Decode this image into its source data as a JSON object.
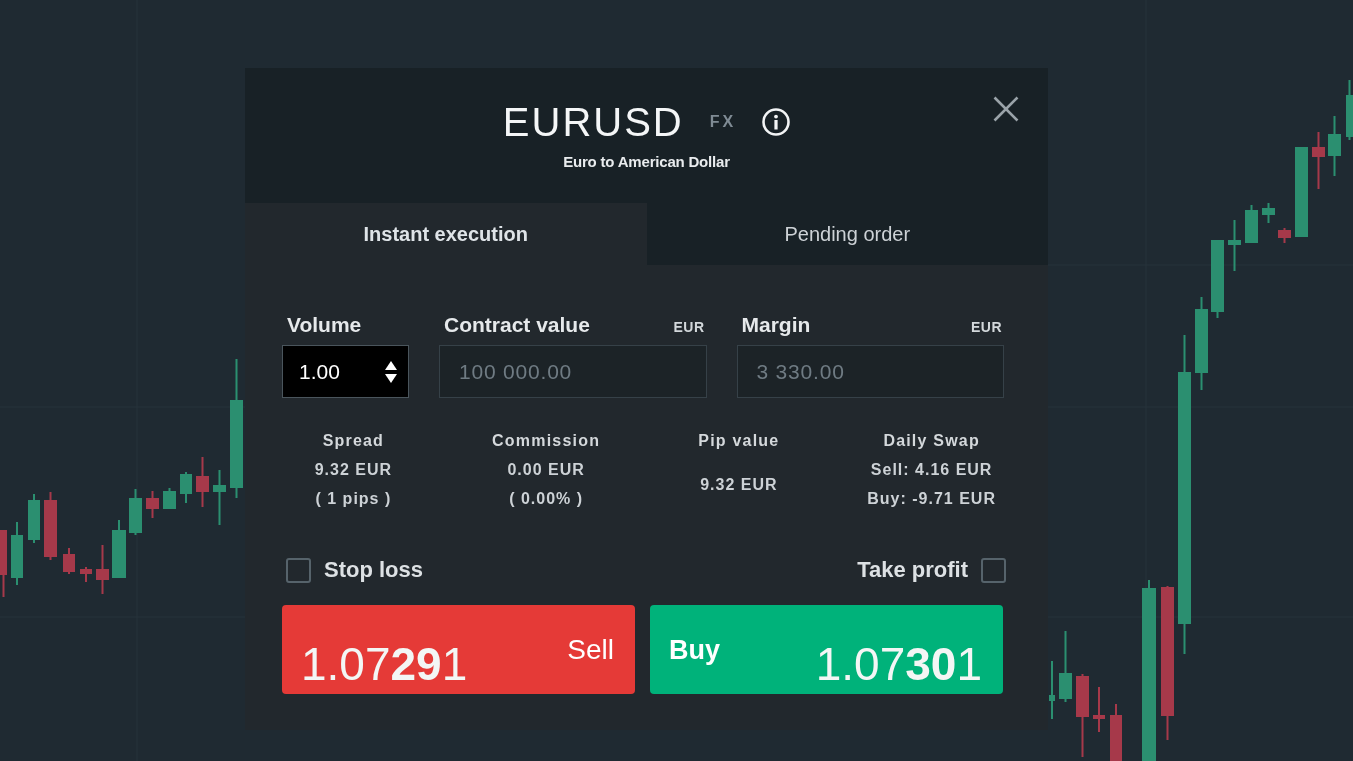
{
  "dialog": {
    "title": "EURUSD",
    "market_tag": "FX",
    "subtitle": "Euro to American Dollar",
    "tabs": [
      {
        "label": "Instant execution",
        "selected": true
      },
      {
        "label": "Pending order",
        "selected": false
      }
    ],
    "fields": [
      {
        "kind": "spinner",
        "label": "Volume",
        "value": "1.00",
        "disabled": false
      },
      {
        "kind": "text",
        "label": "Contract value",
        "unit": "EUR",
        "value": "100 000.00",
        "disabled": true
      },
      {
        "kind": "text",
        "label": "Margin",
        "unit": "EUR",
        "value": "3 330.00",
        "disabled": true
      }
    ],
    "stats": [
      {
        "title": "Spread",
        "lines": [
          "9.32 EUR",
          "( 1 pips )"
        ]
      },
      {
        "title": "Commission",
        "lines": [
          "0.00 EUR",
          "( 0.00% )"
        ]
      },
      {
        "title": "Pip value",
        "lines": [
          "9.32 EUR"
        ]
      },
      {
        "title": "Daily Swap",
        "lines": [
          "Sell: 4.16 EUR",
          "Buy: -9.71 EUR"
        ]
      }
    ],
    "options": [
      {
        "label": "Stop loss",
        "checked": false
      },
      {
        "label": "Take profit",
        "checked": false
      }
    ],
    "order_buttons": [
      {
        "kind": "sell",
        "label": "Sell",
        "price": "1.07**29**1"
      },
      {
        "kind": "buy",
        "label": "Buy",
        "price": "1.07**30**1"
      }
    ]
  }
}
